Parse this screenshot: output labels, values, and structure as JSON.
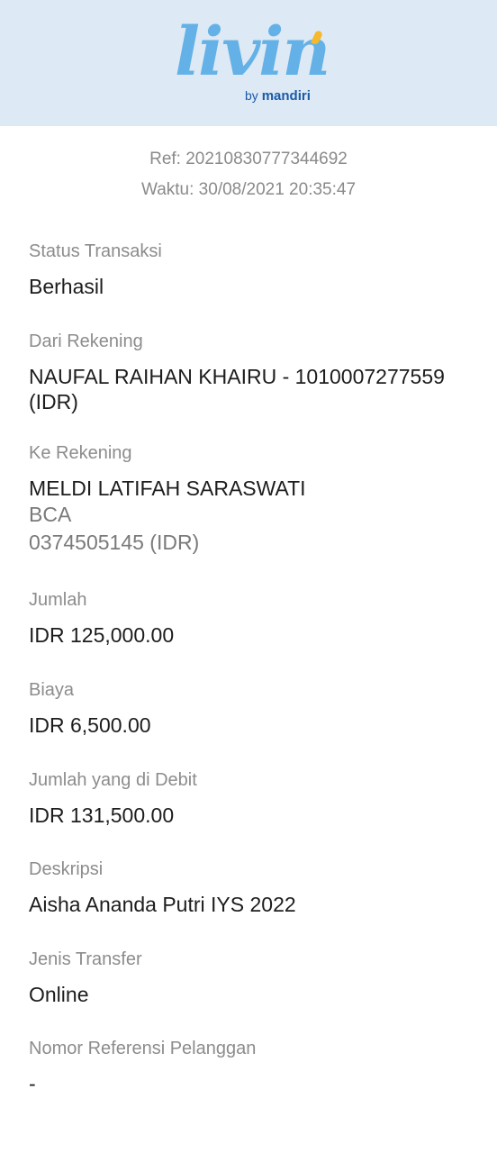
{
  "header": {
    "logo_word": "livin",
    "logo_by": "by",
    "logo_brand": "mandiri",
    "bg_color": "#dde9f5",
    "logo_color": "#63b1e6",
    "accent_color": "#f5b82e",
    "brand_color": "#1a5aa8"
  },
  "meta": {
    "ref": "Ref: 20210830777344692",
    "time": "Waktu: 30/08/2021 20:35:47"
  },
  "fields": {
    "status": {
      "label": "Status Transaksi",
      "value": "Berhasil"
    },
    "from": {
      "label": "Dari Rekening",
      "value": "NAUFAL RAIHAN KHAIRU - 1010007277559 (IDR)"
    },
    "to": {
      "label": "Ke Rekening",
      "value": "MELDI LATIFAH SARASWATI",
      "bank": "BCA",
      "account": "0374505145 (IDR)"
    },
    "amount": {
      "label": "Jumlah",
      "value": "IDR 125,000.00"
    },
    "fee": {
      "label": "Biaya",
      "value": "IDR 6,500.00"
    },
    "debit": {
      "label": "Jumlah yang di Debit",
      "value": "IDR 131,500.00"
    },
    "description": {
      "label": "Deskripsi",
      "value": "Aisha Ananda Putri IYS 2022"
    },
    "transfer_type": {
      "label": "Jenis Transfer",
      "value": "Online"
    },
    "customer_ref": {
      "label": "Nomor Referensi Pelanggan",
      "value": "-"
    }
  }
}
